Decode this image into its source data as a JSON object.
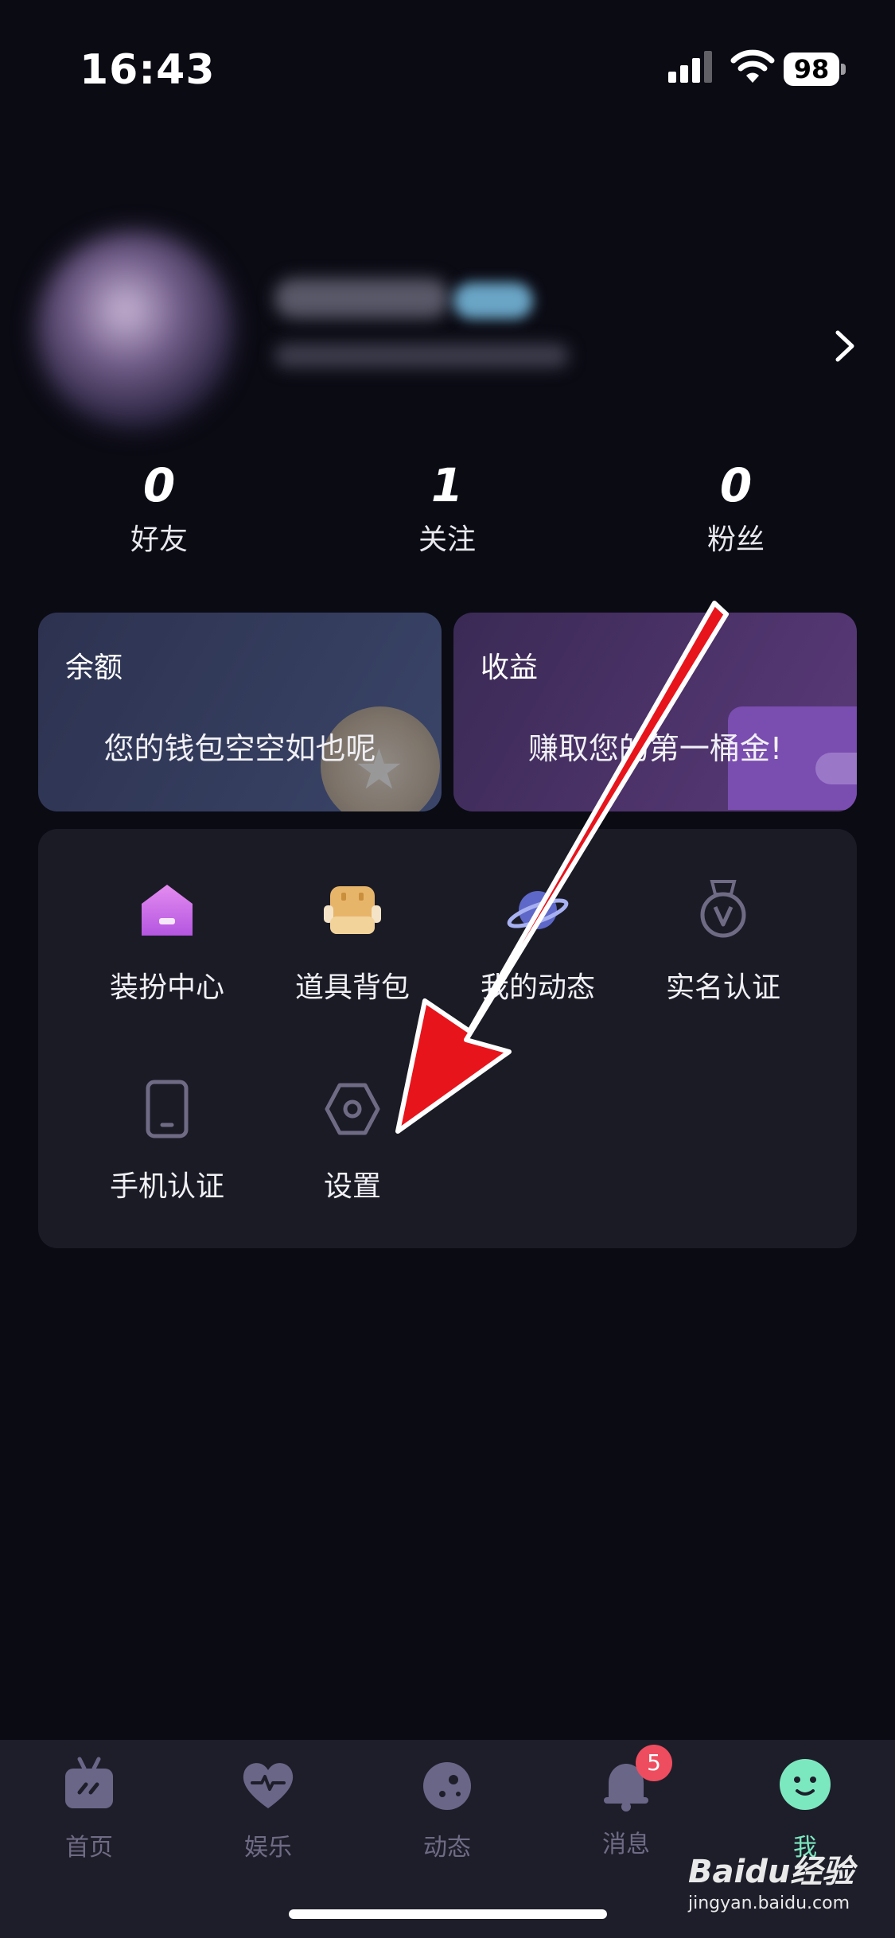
{
  "status_bar": {
    "time": "16:43",
    "battery": "98"
  },
  "stats": [
    {
      "value": "0",
      "label": "好友"
    },
    {
      "value": "1",
      "label": "关注"
    },
    {
      "value": "0",
      "label": "粉丝"
    }
  ],
  "cards": {
    "balance": {
      "title": "余额",
      "desc": "您的钱包空空如也呢"
    },
    "income": {
      "title": "收益",
      "desc": "赚取您的第一桶金!"
    }
  },
  "menu": [
    {
      "label": "装扮中心",
      "icon": "house-icon"
    },
    {
      "label": "道具背包",
      "icon": "backpack-icon"
    },
    {
      "label": "我的动态",
      "icon": "planet-icon"
    },
    {
      "label": "实名认证",
      "icon": "medal-icon"
    },
    {
      "label": "手机认证",
      "icon": "phone-icon"
    },
    {
      "label": "设置",
      "icon": "hexagon-settings-icon"
    }
  ],
  "tabs": [
    {
      "label": "首页",
      "icon": "tv-icon"
    },
    {
      "label": "娱乐",
      "icon": "heart-icon"
    },
    {
      "label": "动态",
      "icon": "planet-icon"
    },
    {
      "label": "消息",
      "icon": "bell-icon",
      "badge": "5"
    },
    {
      "label": "我",
      "icon": "smile-icon",
      "active": true
    }
  ],
  "watermark": {
    "brand": "Baidu经验",
    "url": "jingyan.baidu.com"
  },
  "colors": {
    "background": "#0b0b14",
    "active_tab": "#7ce8c0",
    "annotation_arrow": "#e8141c",
    "badge": "#ee4d5f"
  }
}
